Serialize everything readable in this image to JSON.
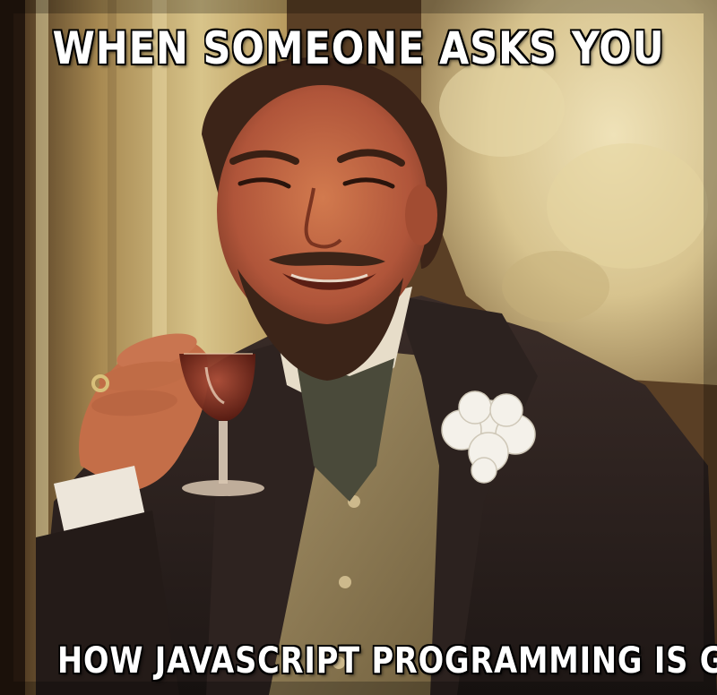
{
  "meme": {
    "top_text": "WHEN SOMEONE ASKS YOU",
    "bottom_text": "HOW JAVASCRIPT PROGRAMMING IS GOING"
  },
  "colors": {
    "caption_fill": "#ffffff",
    "caption_outline": "#000000",
    "suit": "#2b2220",
    "vest": "#8c7a52",
    "background_wall": "#c9b47a",
    "carnation": "#f4f1ea",
    "wine": "#7a2a1e"
  }
}
